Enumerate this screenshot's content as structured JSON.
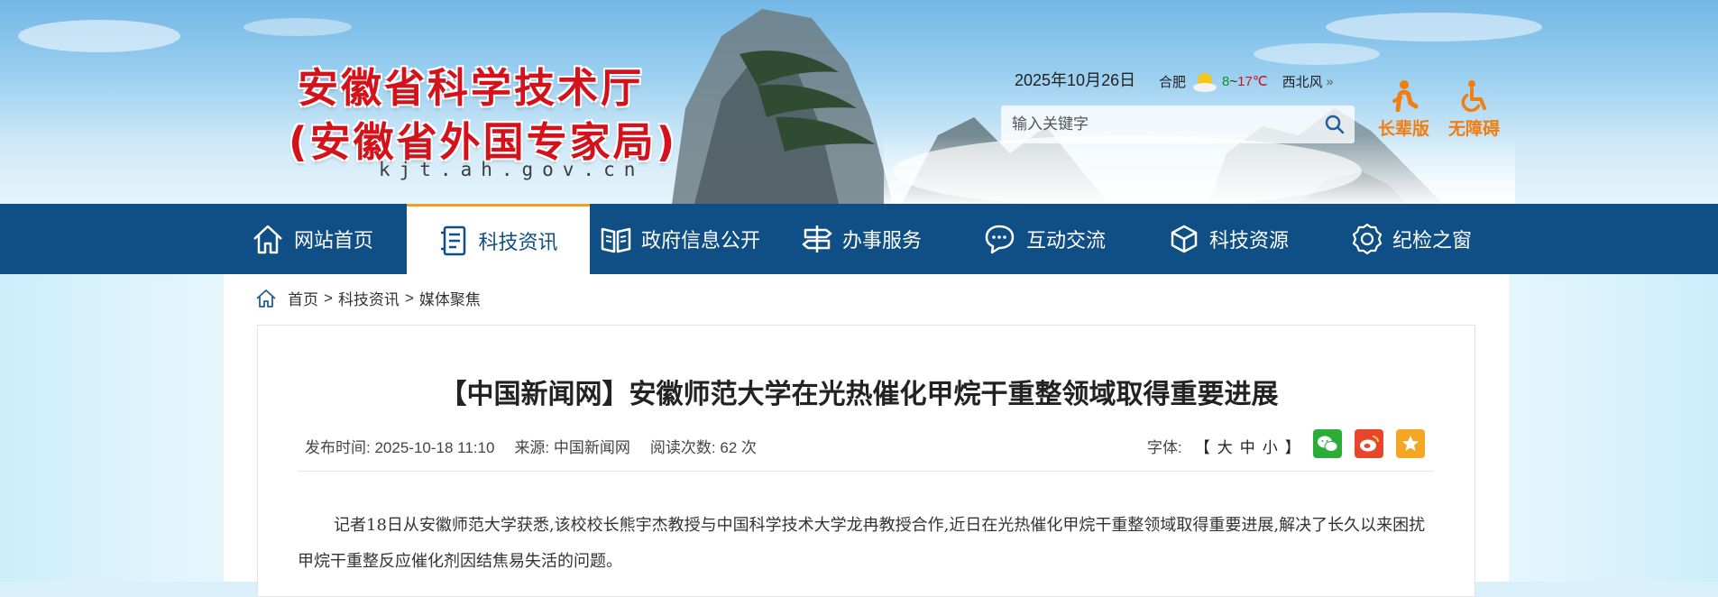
{
  "header": {
    "title_line1": "安徽省科学技术厅",
    "title_line2": "(安徽省外国专家局)",
    "domain": "kjt.ah.gov.cn",
    "date": "2025年10月26日",
    "weather": {
      "city": "合肥",
      "icon": "sun-cloud-icon",
      "temp_low": "8",
      "tilde": "~",
      "temp_high": "17℃",
      "wind": "西北风",
      "more": "»"
    },
    "search": {
      "placeholder": "输入关键字"
    },
    "elder_label": "长辈版",
    "accessible_label": "无障碍",
    "accent_color": "#f07e12"
  },
  "nav": {
    "items": [
      {
        "label": "网站首页",
        "icon": "home-icon"
      },
      {
        "label": "科技资讯",
        "icon": "document-icon",
        "active": true
      },
      {
        "label": "政府信息公开",
        "icon": "book-icon"
      },
      {
        "label": "办事服务",
        "icon": "signpost-icon"
      },
      {
        "label": "互动交流",
        "icon": "chat-icon"
      },
      {
        "label": "科技资源",
        "icon": "cube-icon"
      },
      {
        "label": "纪检之窗",
        "icon": "badge-icon"
      }
    ],
    "bg_color": "#0f4f85"
  },
  "breadcrumb": {
    "home": "首页",
    "sep1": ">",
    "section": "科技资讯",
    "sep2": ">",
    "current": "媒体聚焦"
  },
  "article": {
    "title": "【中国新闻网】安徽师范大学在光热催化甲烷干重整领域取得重要进展",
    "publish_label": "发布时间:",
    "publish_time": "2025-10-18 11:10",
    "source_label": "来源:",
    "source": "中国新闻网",
    "views_label": "阅读次数:",
    "views": "62 次",
    "font_label": "字体:",
    "font_open": "【",
    "font_large": "大",
    "font_medium": "中",
    "font_small": "小",
    "font_close": "】",
    "share": [
      "wechat-icon",
      "weibo-icon",
      "favorite-icon"
    ],
    "body": "记者18日从安徽师范大学获悉,该校校长熊宇杰教授与中国科学技术大学龙冉教授合作,近日在光热催化甲烷干重整领域取得重要进展,解决了长久以来困扰甲烷干重整反应催化剂因结焦易失活的问题。"
  }
}
